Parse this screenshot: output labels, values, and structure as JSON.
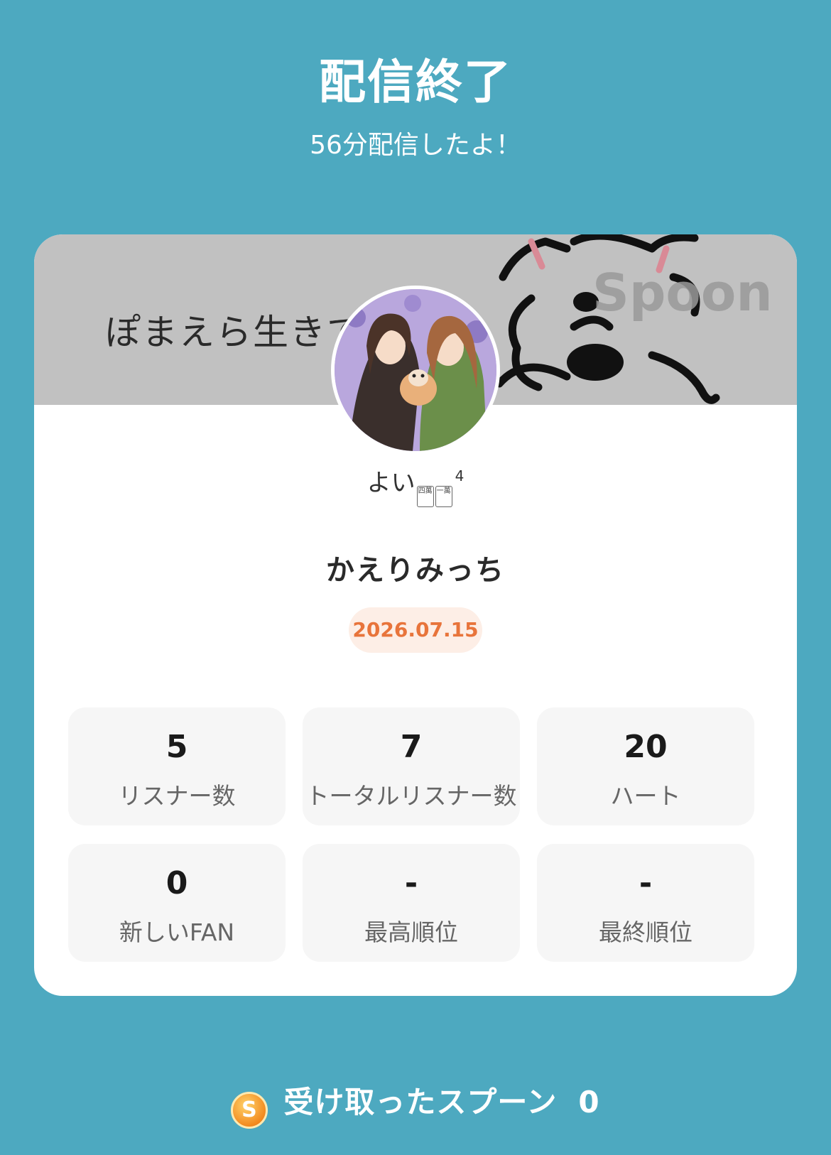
{
  "header": {
    "title": "配信終了",
    "subtitle": "56分配信したよ！"
  },
  "banner": {
    "text": "ぽまえら生きて",
    "watermark": "Spoon"
  },
  "profile": {
    "nickname": "よい",
    "nickname_tiles": [
      "四萬",
      "一萬"
    ],
    "nickname_superscript": "4",
    "display_name": "かえりみっち",
    "date": "2026.07.15"
  },
  "stats": [
    {
      "value": "5",
      "label": "リスナー数"
    },
    {
      "value": "7",
      "label": "トータルリスナー数"
    },
    {
      "value": "20",
      "label": "ハート"
    },
    {
      "value": "0",
      "label": "新しいFAN"
    },
    {
      "value": "-",
      "label": "最高順位"
    },
    {
      "value": "-",
      "label": "最終順位"
    }
  ],
  "spoons": {
    "icon_letter": "S",
    "label": "受け取ったスプーン",
    "count": "0"
  },
  "colors": {
    "background": "#4da9c0",
    "date_accent": "#e8743b",
    "date_badge_bg": "#fdeee6"
  }
}
